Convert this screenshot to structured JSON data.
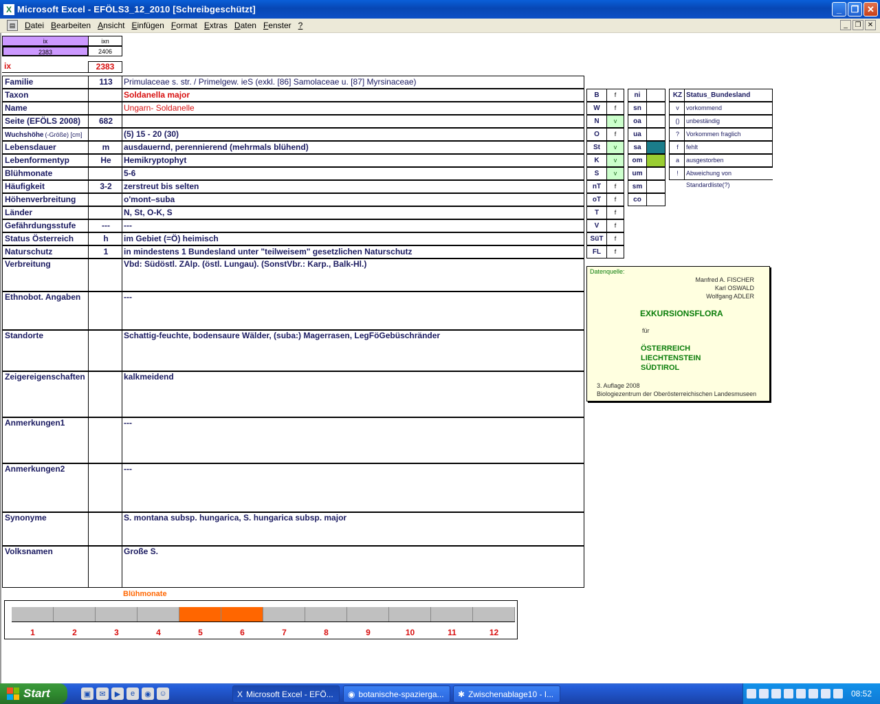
{
  "window": {
    "title": "Microsoft Excel - EFÖLS3_12_2010  [Schreibgeschützt]",
    "icon": "excel-icon"
  },
  "menu": [
    "Datei",
    "Bearbeiten",
    "Ansicht",
    "Einfügen",
    "Format",
    "Extras",
    "Daten",
    "Fenster",
    "?"
  ],
  "top": {
    "ix_h": "ix",
    "ixn_h": "ixn",
    "ix_v": "2383",
    "ixn_v": "2406",
    "ix_label": "ix",
    "ix_value": "2383"
  },
  "rows": [
    {
      "label": "Familie",
      "code": "113",
      "value": "Primulaceae s. str.  /  Primelgew. ieS (exkl. [86] Samolaceae u. [87] Myrsinaceae)"
    },
    {
      "label": "Taxon",
      "code": "",
      "value": "Soldanella major"
    },
    {
      "label": "Name",
      "code": "",
      "value": "Ungarn- Soldanelle"
    },
    {
      "label": "Seite (EFÖLS 2008)",
      "code": "682",
      "value": ""
    },
    {
      "label": "Wuchshöhe",
      "label_sub": "(-Größe) [cm]",
      "code": "",
      "value": " (5) 15 - 20 (30)"
    },
    {
      "label": "Lebensdauer",
      "code": "m",
      "value": "ausdauernd, perennierend (mehrmals blühend)"
    },
    {
      "label": "Lebenformentyp",
      "code": "He",
      "value": "Hemikryptophyt"
    },
    {
      "label": "Blühmonate",
      "code": "",
      "value": " 5-6"
    },
    {
      "label": "Häufigkeit",
      "code": "3-2",
      "value": "zerstreut bis selten"
    },
    {
      "label": "Höhenverbreitung",
      "code": "",
      "value": "o'mont–suba"
    },
    {
      "label": "Länder",
      "code": "",
      "value": "N, St, O-K, S"
    },
    {
      "label": "Gefährdungsstufe",
      "code": "---",
      "value": "  ---"
    },
    {
      "label": "Status Österreich",
      "code": "h",
      "value": "im Gebiet (=Ö) heimisch"
    },
    {
      "label": "Naturschutz",
      "code": "1",
      "value": "in mindestens 1 Bundesland unter \"teilweisem\" gesetzlichen Naturschutz"
    },
    {
      "label": "Verbreitung",
      "code": "",
      "value": "Vbd:  Südöstl. ZAlp.  (östl. Lungau). (SonstVbr.: Karp., Balk-Hl.)"
    },
    {
      "label": "Ethnobot. Angaben",
      "code": "",
      "value": "---"
    },
    {
      "label": "Standorte",
      "code": "",
      "value": "Schattig-feuchte, bodensaure Wälder, (suba:) Magerrasen, LegFöGebüschränder"
    },
    {
      "label": "Zeigereigenschaften",
      "code": "",
      "value": "kalkmeidend"
    },
    {
      "label": "Anmerkungen1",
      "code": "",
      "value": "---"
    },
    {
      "label": "Anmerkungen2",
      "code": "",
      "value": "---"
    },
    {
      "label": "Synonyme",
      "code": "",
      "value": "S. montana subsp. hungarica, S. hungarica subsp. major"
    },
    {
      "label": "Volksnamen",
      "code": "",
      "value": "Große S."
    }
  ],
  "bundeslaender": [
    {
      "code": "B",
      "v": "f",
      "on": false
    },
    {
      "code": "W",
      "v": "f",
      "on": false
    },
    {
      "code": "N",
      "v": "v",
      "on": true
    },
    {
      "code": "O",
      "v": "f",
      "on": false
    },
    {
      "code": "St",
      "v": "v",
      "on": true
    },
    {
      "code": "K",
      "v": "v",
      "on": true
    },
    {
      "code": "S",
      "v": "v",
      "on": true
    },
    {
      "code": "nT",
      "v": "f",
      "on": false
    },
    {
      "code": "oT",
      "v": "f",
      "on": false
    },
    {
      "code": "T",
      "v": "f",
      "on": false
    },
    {
      "code": "V",
      "v": "f",
      "on": false
    },
    {
      "code": "SüT",
      "v": "f",
      "on": false
    },
    {
      "code": "FL",
      "v": "f",
      "on": false
    }
  ],
  "hoehen": [
    {
      "code": "ni",
      "fill": ""
    },
    {
      "code": "sn",
      "fill": ""
    },
    {
      "code": "oa",
      "fill": ""
    },
    {
      "code": "ua",
      "fill": ""
    },
    {
      "code": "sa",
      "fill": "#1b7d8a"
    },
    {
      "code": "om",
      "fill": "#9acd32"
    },
    {
      "code": "um",
      "fill": ""
    },
    {
      "code": "sm",
      "fill": ""
    },
    {
      "code": "co",
      "fill": ""
    }
  ],
  "kz": {
    "h1": "KZ",
    "h2": "Status_Bundesland",
    "items": [
      {
        "k": "v",
        "t": "vorkommend"
      },
      {
        "k": "()",
        "t": "unbeständig"
      },
      {
        "k": "?",
        "t": "Vorkommen fraglich"
      },
      {
        "k": "f",
        "t": "fehlt"
      },
      {
        "k": "a",
        "t": "ausgestorben"
      },
      {
        "k": "!",
        "t": "Abweichung von Standardliste(?)"
      }
    ]
  },
  "source": {
    "label": "Datenquelle:",
    "authors": [
      "Manfred A. FISCHER",
      "Karl OSWALD",
      "Wolfgang ADLER"
    ],
    "title": "EXKURSIONSFLORA",
    "fuer": "für",
    "countries": [
      "ÖSTERREICH",
      "LIECHTENSTEIN",
      "SÜDTIROL"
    ],
    "edition": "3. Auflage 2008",
    "publisher": "Biologiezentrum der Oberösterreichischen Landesmuseen"
  },
  "chart_data": {
    "type": "bar",
    "title": "Blühmonate",
    "categories": [
      "1",
      "2",
      "3",
      "4",
      "5",
      "6",
      "7",
      "8",
      "9",
      "10",
      "11",
      "12"
    ],
    "values": [
      0,
      0,
      0,
      0,
      1,
      1,
      0,
      0,
      0,
      0,
      0,
      0
    ],
    "colors": {
      "on": "#ff6600",
      "off": "#c0c0c0"
    }
  },
  "taskbar": {
    "start": "Start",
    "buttons": [
      "Microsoft Excel - EFÖ...",
      "botanische-spazierga...",
      "Zwischenablage10 - I..."
    ],
    "clock": "08:52"
  }
}
